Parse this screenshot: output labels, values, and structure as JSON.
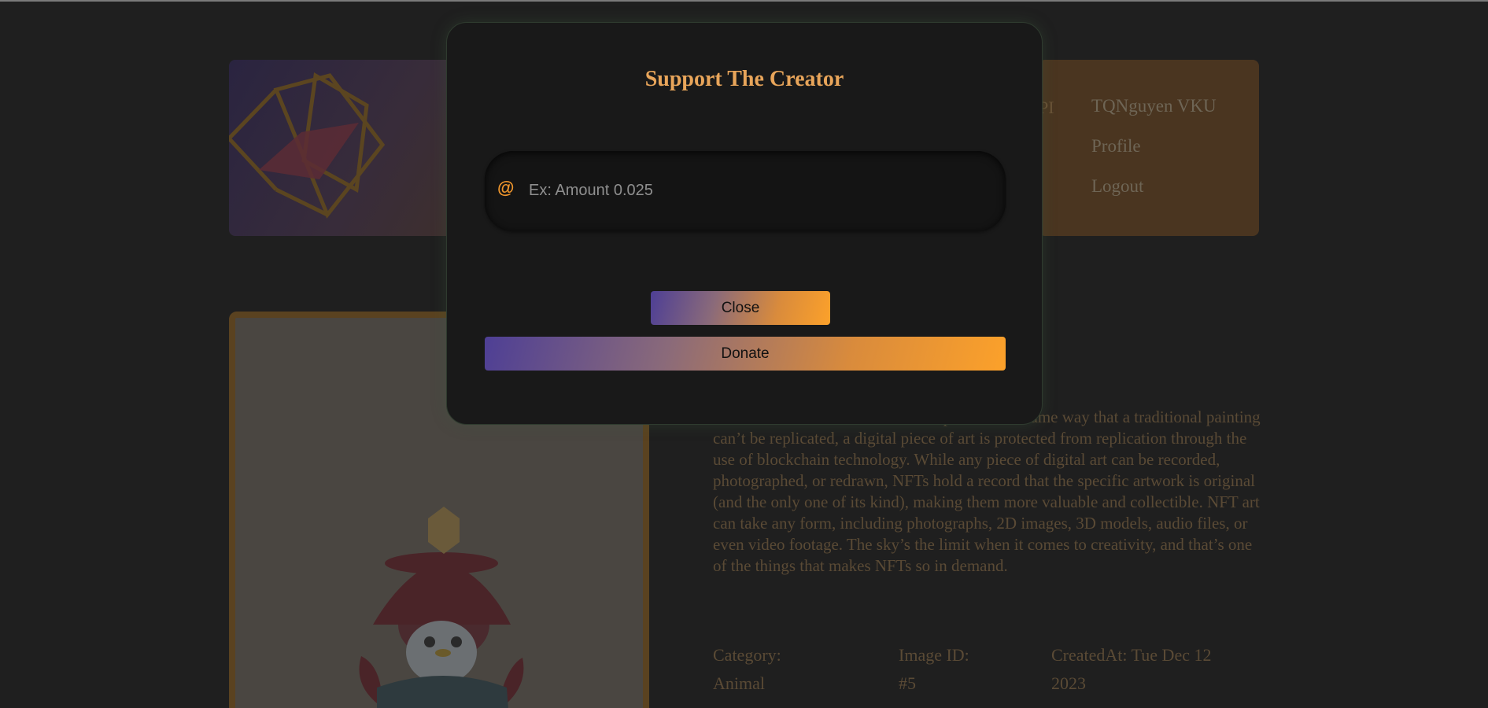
{
  "nav": {
    "fragment": "PI",
    "items": [
      "TQNguyen VKU",
      "Profile",
      "Logout"
    ]
  },
  "description": "collected and traded in the online space. In the same way that a traditional painting can’t be replicated, a digital piece of art is protected from replication through the use of blockchain technology. While any piece of digital art can be recorded, photographed, or redrawn, NFTs hold a record that the specific artwork is original (and the only one of its kind), making them more valuable and collectible. NFT art can take any form, including photographs, 2D images, 3D models, audio files, or even video footage. The sky’s the limit when it comes to creativity, and that’s one of the things that makes NFTs so in demand.",
  "meta": {
    "category_label": "Category:",
    "category_value": "Animal",
    "image_id_label": "Image ID:",
    "image_id_value": "#5",
    "created_label": "CreatedAt: Tue Dec 12",
    "created_value": "2023"
  },
  "modal": {
    "title": "Support The Creator",
    "input_placeholder": "Ex: Amount 0.025",
    "input_value": "",
    "close_label": "Close",
    "donate_label": "Donate"
  },
  "icons": {
    "amount_prefix": "@"
  },
  "colors": {
    "accent_orange": "#fca12a",
    "accent_purple": "#4e3f95",
    "title_color": "#e8a55a"
  }
}
